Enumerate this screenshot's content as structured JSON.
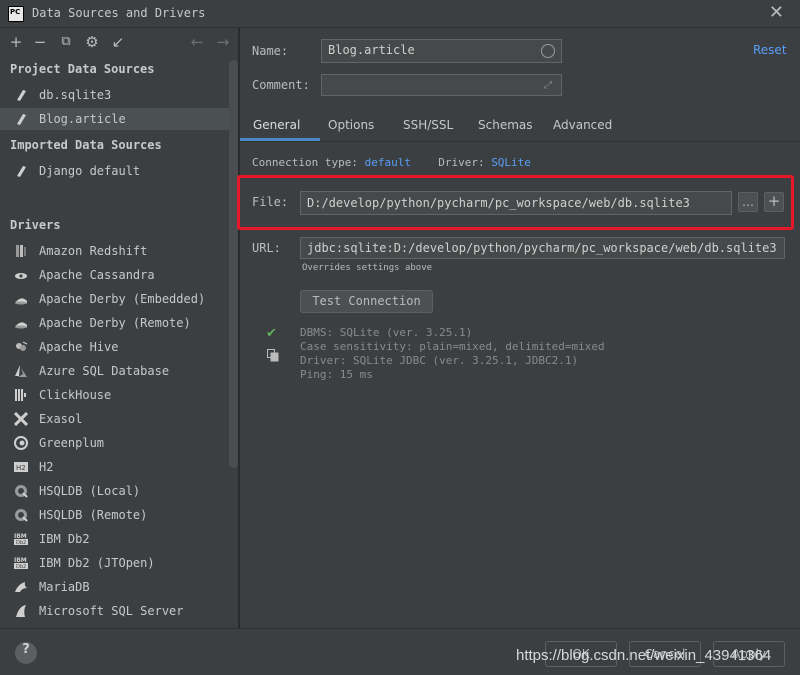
{
  "window": {
    "title": "Data Sources and Drivers",
    "app_icon_text": "PC"
  },
  "toolbar": {
    "add": "+",
    "remove": "−",
    "copy": "⧉",
    "settings": "⚙",
    "import": "↙",
    "back": "←",
    "forward": "→"
  },
  "sidebar": {
    "project_header": "Project Data Sources",
    "project_items": [
      "db.sqlite3",
      "Blog.article"
    ],
    "imported_header": "Imported Data Sources",
    "imported_items": [
      "Django default"
    ],
    "drivers_header": "Drivers",
    "drivers": [
      "Amazon Redshift",
      "Apache Cassandra",
      "Apache Derby (Embedded)",
      "Apache Derby (Remote)",
      "Apache Hive",
      "Azure SQL Database",
      "ClickHouse",
      "Exasol",
      "Greenplum",
      "H2",
      "HSQLDB (Local)",
      "HSQLDB (Remote)",
      "IBM Db2",
      "IBM Db2 (JTOpen)",
      "MariaDB",
      "Microsoft SQL Server"
    ]
  },
  "form": {
    "name_label": "Name:",
    "name_value": "Blog.article",
    "comment_label": "Comment:",
    "comment_value": "",
    "reset": "Reset"
  },
  "tabs": [
    "General",
    "Options",
    "SSH/SSL",
    "Schemas",
    "Advanced"
  ],
  "general": {
    "conn_type_label": "Connection type:",
    "conn_type_value": "default",
    "driver_label": "Driver:",
    "driver_value": "SQLite",
    "file_label": "File:",
    "file_value": "D:/develop/python/pycharm/pc_workspace/web/db.sqlite3",
    "browse": "…",
    "add": "+",
    "url_label": "URL:",
    "url_value": "jdbc:sqlite:D:/develop/python/pycharm/pc_workspace/web/db.sqlite3",
    "url_hint": "Overrides settings above",
    "test_button": "Test Connection",
    "info": [
      "DBMS: SQLite (ver. 3.25.1)",
      "Case sensitivity: plain=mixed, delimited=mixed",
      "Driver: SQLite JDBC (ver. 3.25.1, JDBC2.1)",
      "Ping: 15 ms"
    ]
  },
  "footer": {
    "help": "?",
    "ok": "OK",
    "cancel": "Cancel",
    "apply": "Apply",
    "watermark": "https://blog.csdn.net/weixin_43941364"
  }
}
